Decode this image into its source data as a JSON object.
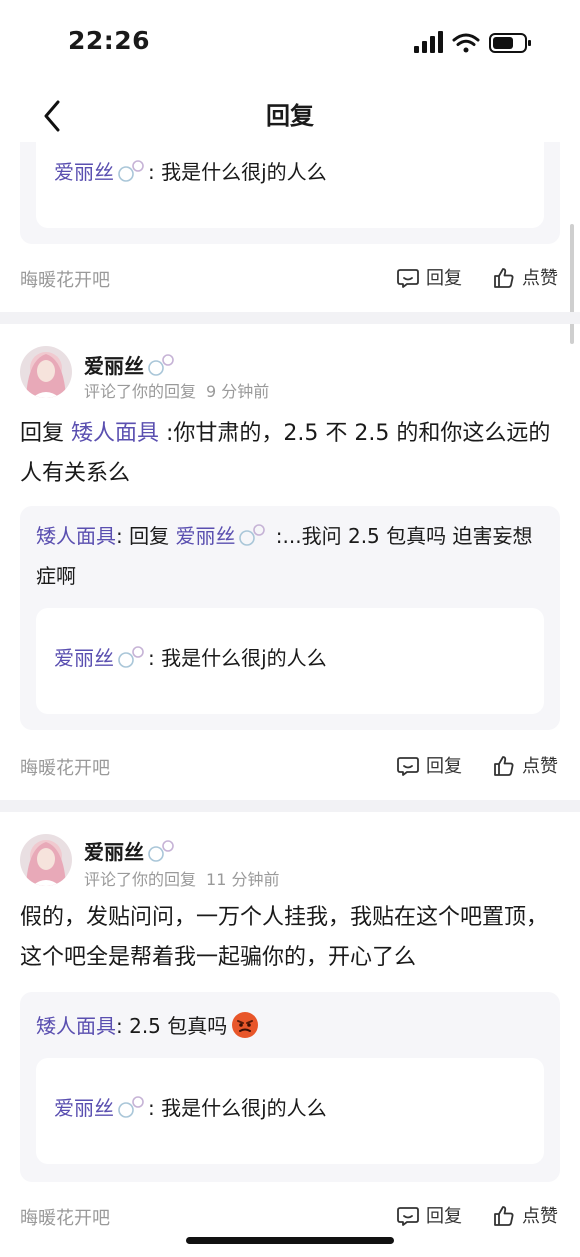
{
  "status": {
    "time": "22:26"
  },
  "nav": {
    "title": "回复"
  },
  "forum_name": "晦暖花开吧",
  "action_labels": {
    "reply": "回复",
    "like": "点赞"
  },
  "posts": [
    {
      "quote_inner": {
        "user": "爱丽丝",
        "text": ": 我是什么很j的人么"
      }
    },
    {
      "user": "爱丽丝",
      "meta": "评论了你的回复",
      "time": "9 分钟前",
      "comment": {
        "prefix": "回复 ",
        "mention": "矮人面具",
        "text": " :你甘肃的，2.5 不 2.5 的和你这么远的人有关系么"
      },
      "quote": {
        "user": "矮人面具",
        "sep": ": 回复 ",
        "mention": "爱丽丝",
        "text": " :...我问 2.5 包真吗 迫害妄想症啊"
      },
      "quote_inner": {
        "user": "爱丽丝",
        "text": ": 我是什么很j的人么"
      }
    },
    {
      "user": "爱丽丝",
      "meta": "评论了你的回复",
      "time": "11 分钟前",
      "comment": {
        "text": "假的，发贴问问，一万个人挂我，我贴在这个吧置顶，这个吧全是帮着我一起骗你的，开心了么"
      },
      "quote": {
        "user": "矮人面具",
        "text": ": 2.5 包真吗"
      },
      "quote_inner": {
        "user": "爱丽丝",
        "text": ": 我是什么很j的人么"
      }
    }
  ],
  "colors": {
    "mention": "#5a4fb0",
    "gap": "#f2f2f5",
    "quote_bg": "#f6f6f9"
  }
}
